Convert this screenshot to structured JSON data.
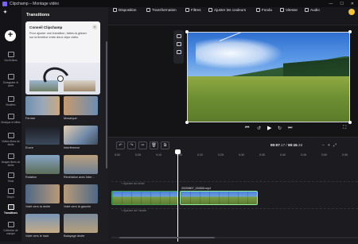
{
  "window": {
    "title": "Clipchamp – Montage vidéo"
  },
  "leftrail": {
    "logo": "✦",
    "items": [
      {
        "label": "Vos fichiers",
        "icon": "folder-icon"
      },
      {
        "label": "Enregistrer et créer",
        "icon": "camera-icon"
      },
      {
        "label": "Modèles",
        "icon": "templates-icon"
      },
      {
        "label": "Musique et effets",
        "icon": "music-icon"
      },
      {
        "label": "Vidéos libres de droits",
        "icon": "film-icon"
      },
      {
        "label": "Images libres de droits",
        "icon": "image-icon"
      },
      {
        "label": "Texte",
        "icon": "text-icon"
      },
      {
        "label": "Graph.",
        "icon": "shapes-icon"
      },
      {
        "label": "Transitions",
        "icon": "transitions-icon"
      },
      {
        "label": "Collection de marque",
        "icon": "brand-icon"
      }
    ]
  },
  "panel": {
    "title": "Transitions",
    "tip": {
      "title": "Conseil Clipchamp",
      "text": "Pour ajouter une transition, faites-la glisser sur la timeline entre deux clips vidéo.",
      "close": "×"
    },
    "tiles": [
      {
        "label": "Fermer"
      },
      {
        "label": "Mosaïque"
      },
      {
        "label": "Encre"
      },
      {
        "label": "Interférence"
      },
      {
        "label": "Rotation"
      },
      {
        "label": "Révélation avec inter…"
      },
      {
        "label": "Volet vers la droite"
      },
      {
        "label": "Volet vers la gauche"
      },
      {
        "label": "Volet vers le haut"
      },
      {
        "label": "Balayage droite"
      }
    ]
  },
  "toolbar": {
    "buttons": [
      {
        "label": "Disposition"
      },
      {
        "label": "Transformation"
      },
      {
        "label": "Filtres"
      },
      {
        "label": "Ajuster les couleurs"
      },
      {
        "label": "Fondu"
      },
      {
        "label": "Vitesse"
      },
      {
        "label": "Audio"
      }
    ]
  },
  "player": {
    "skip_back": "⏮",
    "rewind": "↺",
    "play": "▶",
    "forward": "↻",
    "skip_forward": "⏭",
    "fullscreen": "⛶"
  },
  "timeline": {
    "tools": {
      "undo": "↶",
      "redo": "↷",
      "cut": "✂",
      "delete": "🗑",
      "duplicate": "⧉"
    },
    "timecode": {
      "current": "00:07",
      "current_frac": ".17",
      "separator": " / ",
      "total": "00:15",
      "total_frac": ".33"
    },
    "zoom": {
      "out": "−",
      "in": "+",
      "fit": "⤢"
    },
    "ticks": [
      "0:00",
      "0:05",
      "0:10",
      "0:15",
      "0:20",
      "0:25",
      "0:30",
      "0:35",
      "0:40",
      "0:45",
      "0:50",
      "0:55"
    ],
    "text_track_label": "+ Ajouter du texte",
    "clip_name": "20200807_151826.mp4",
    "audio_track_label": "+ Ajouter de l'audio"
  }
}
